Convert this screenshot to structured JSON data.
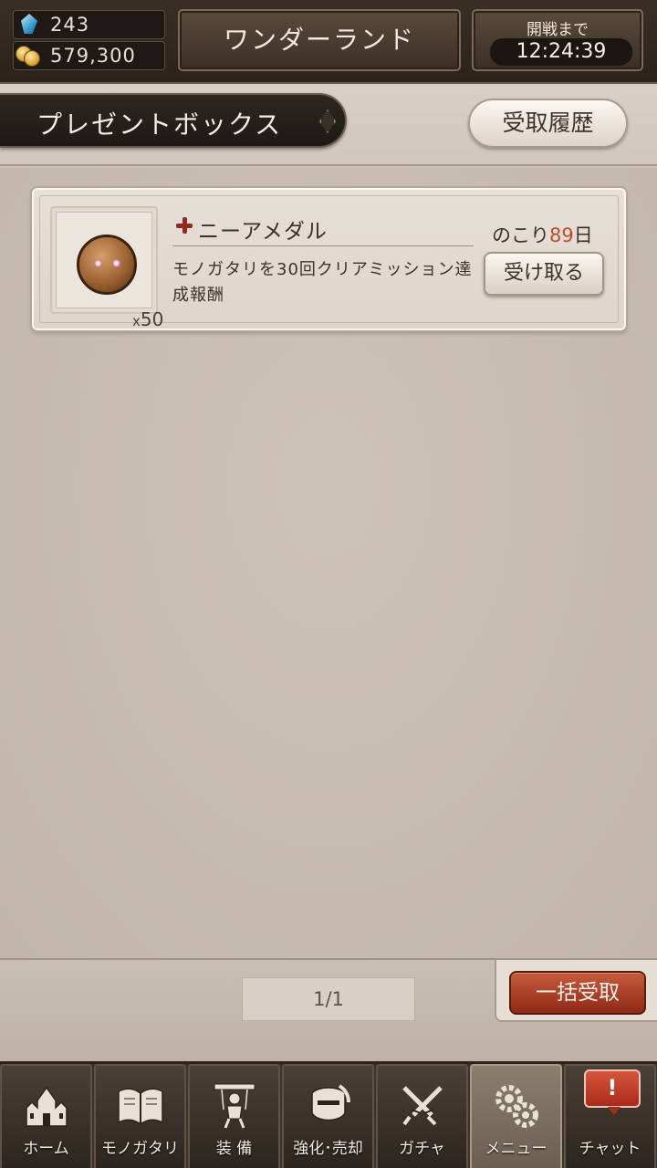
{
  "header": {
    "gems": "243",
    "coins": "579,300",
    "world_name": "ワンダーランド",
    "battle_label": "開戦まで",
    "battle_timer": "12:24:39"
  },
  "titlebar": {
    "title": "プレゼントボックス",
    "history_label": "受取履歴"
  },
  "gifts": [
    {
      "name": "ニーアメダル",
      "quantity_prefix": "x",
      "quantity": "50",
      "description": "モノガタリを30回クリアミッション達成報酬",
      "remain_prefix": "のこり",
      "remain_days": "89",
      "remain_suffix": "日",
      "receive_label": "受け取る"
    }
  ],
  "footer": {
    "page_indicator": "1/1",
    "bulk_receive_label": "一括受取"
  },
  "nav": {
    "items": [
      {
        "label": "ホーム",
        "icon": "castle-icon"
      },
      {
        "label": "モノガタリ",
        "icon": "book-icon"
      },
      {
        "label": "装 備",
        "icon": "puppet-icon"
      },
      {
        "label": "強化･売却",
        "icon": "knight-helmet-icon"
      },
      {
        "label": "ガチャ",
        "icon": "crossed-swords-icon"
      },
      {
        "label": "メニュー",
        "icon": "gears-icon"
      },
      {
        "label": "チャット",
        "icon": "chat-alert-icon"
      }
    ],
    "active_index": 5,
    "chat_alert": "!"
  },
  "colors": {
    "accent_red": "#8e2a17",
    "days_highlight": "#b5502a",
    "header_dark": "#2a221c",
    "panel_bg": "#cbc0b6"
  }
}
